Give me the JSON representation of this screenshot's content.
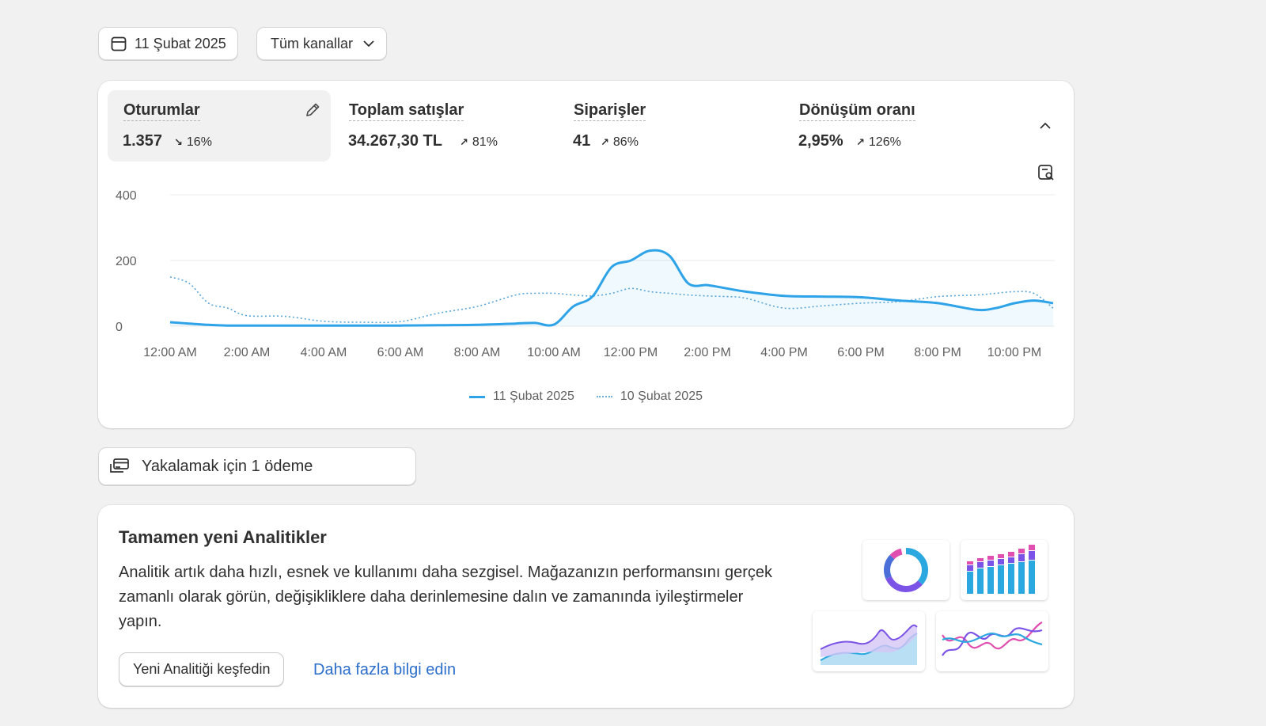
{
  "filters": {
    "date_label": "11 Şubat 2025",
    "channel_label": "Tüm kanallar"
  },
  "metrics": [
    {
      "label": "Oturumlar",
      "value": "1.357",
      "change": "16%",
      "direction": "down"
    },
    {
      "label": "Toplam satışlar",
      "value": "34.267,30 TL",
      "change": "81%",
      "direction": "up"
    },
    {
      "label": "Siparişler",
      "value": "41",
      "change": "86%",
      "direction": "up"
    },
    {
      "label": "Dönüşüm oranı",
      "value": "2,95%",
      "change": "126%",
      "direction": "up"
    }
  ],
  "chart_data": {
    "type": "line",
    "y_ticks": [
      "400",
      "200",
      "0"
    ],
    "ylim": [
      0,
      400
    ],
    "x_ticks": [
      "12:00 AM",
      "2:00 AM",
      "4:00 AM",
      "6:00 AM",
      "8:00 AM",
      "10:00 AM",
      "12:00 PM",
      "2:00 PM",
      "4:00 PM",
      "6:00 PM",
      "8:00 PM",
      "10:00 PM"
    ],
    "x_hours": [
      0,
      0.5,
      1,
      1.5,
      2,
      3,
      4,
      5,
      6,
      7,
      8,
      9,
      9.5,
      10,
      10.5,
      11,
      11.5,
      12,
      12.5,
      13,
      13.5,
      14,
      14.5,
      15,
      16,
      17,
      18,
      19,
      20,
      21,
      21.5,
      22,
      22.5,
      23
    ],
    "grid": true,
    "legend_position": "bottom-center",
    "colors": {
      "primary": "#2ea3e8",
      "comparison": "#6aaed6"
    },
    "series": [
      {
        "name": "11 Şubat 2025",
        "style": "solid",
        "values": [
          12,
          8,
          4,
          2,
          2,
          2,
          2,
          2,
          2,
          3,
          4,
          8,
          10,
          5,
          60,
          90,
          180,
          200,
          230,
          215,
          130,
          125,
          115,
          105,
          92,
          90,
          88,
          78,
          70,
          50,
          55,
          70,
          78,
          70
        ]
      },
      {
        "name": "10 Şubat 2025",
        "style": "dotted",
        "values": [
          150,
          130,
          70,
          55,
          32,
          30,
          15,
          12,
          14,
          40,
          60,
          95,
          100,
          100,
          95,
          92,
          100,
          115,
          105,
          100,
          95,
          92,
          90,
          85,
          55,
          62,
          70,
          75,
          90,
          95,
          100,
          105,
          100,
          55
        ]
      }
    ]
  },
  "payments": {
    "label": "Yakalamak için 1 ödeme"
  },
  "analytics_promo": {
    "title": "Tamamen yeni Analitikler",
    "description": "Analitik artık daha hızlı, esnek ve kullanımı daha sezgisel. Mağazanızın performansını gerçek zamanlı olarak görün, değişikliklere daha derinlemesine dalın ve zamanında iyileştirmeler yapın.",
    "primary_button": "Yeni Analitiği keşfedin",
    "link": "Daha fazla bilgi edin"
  }
}
